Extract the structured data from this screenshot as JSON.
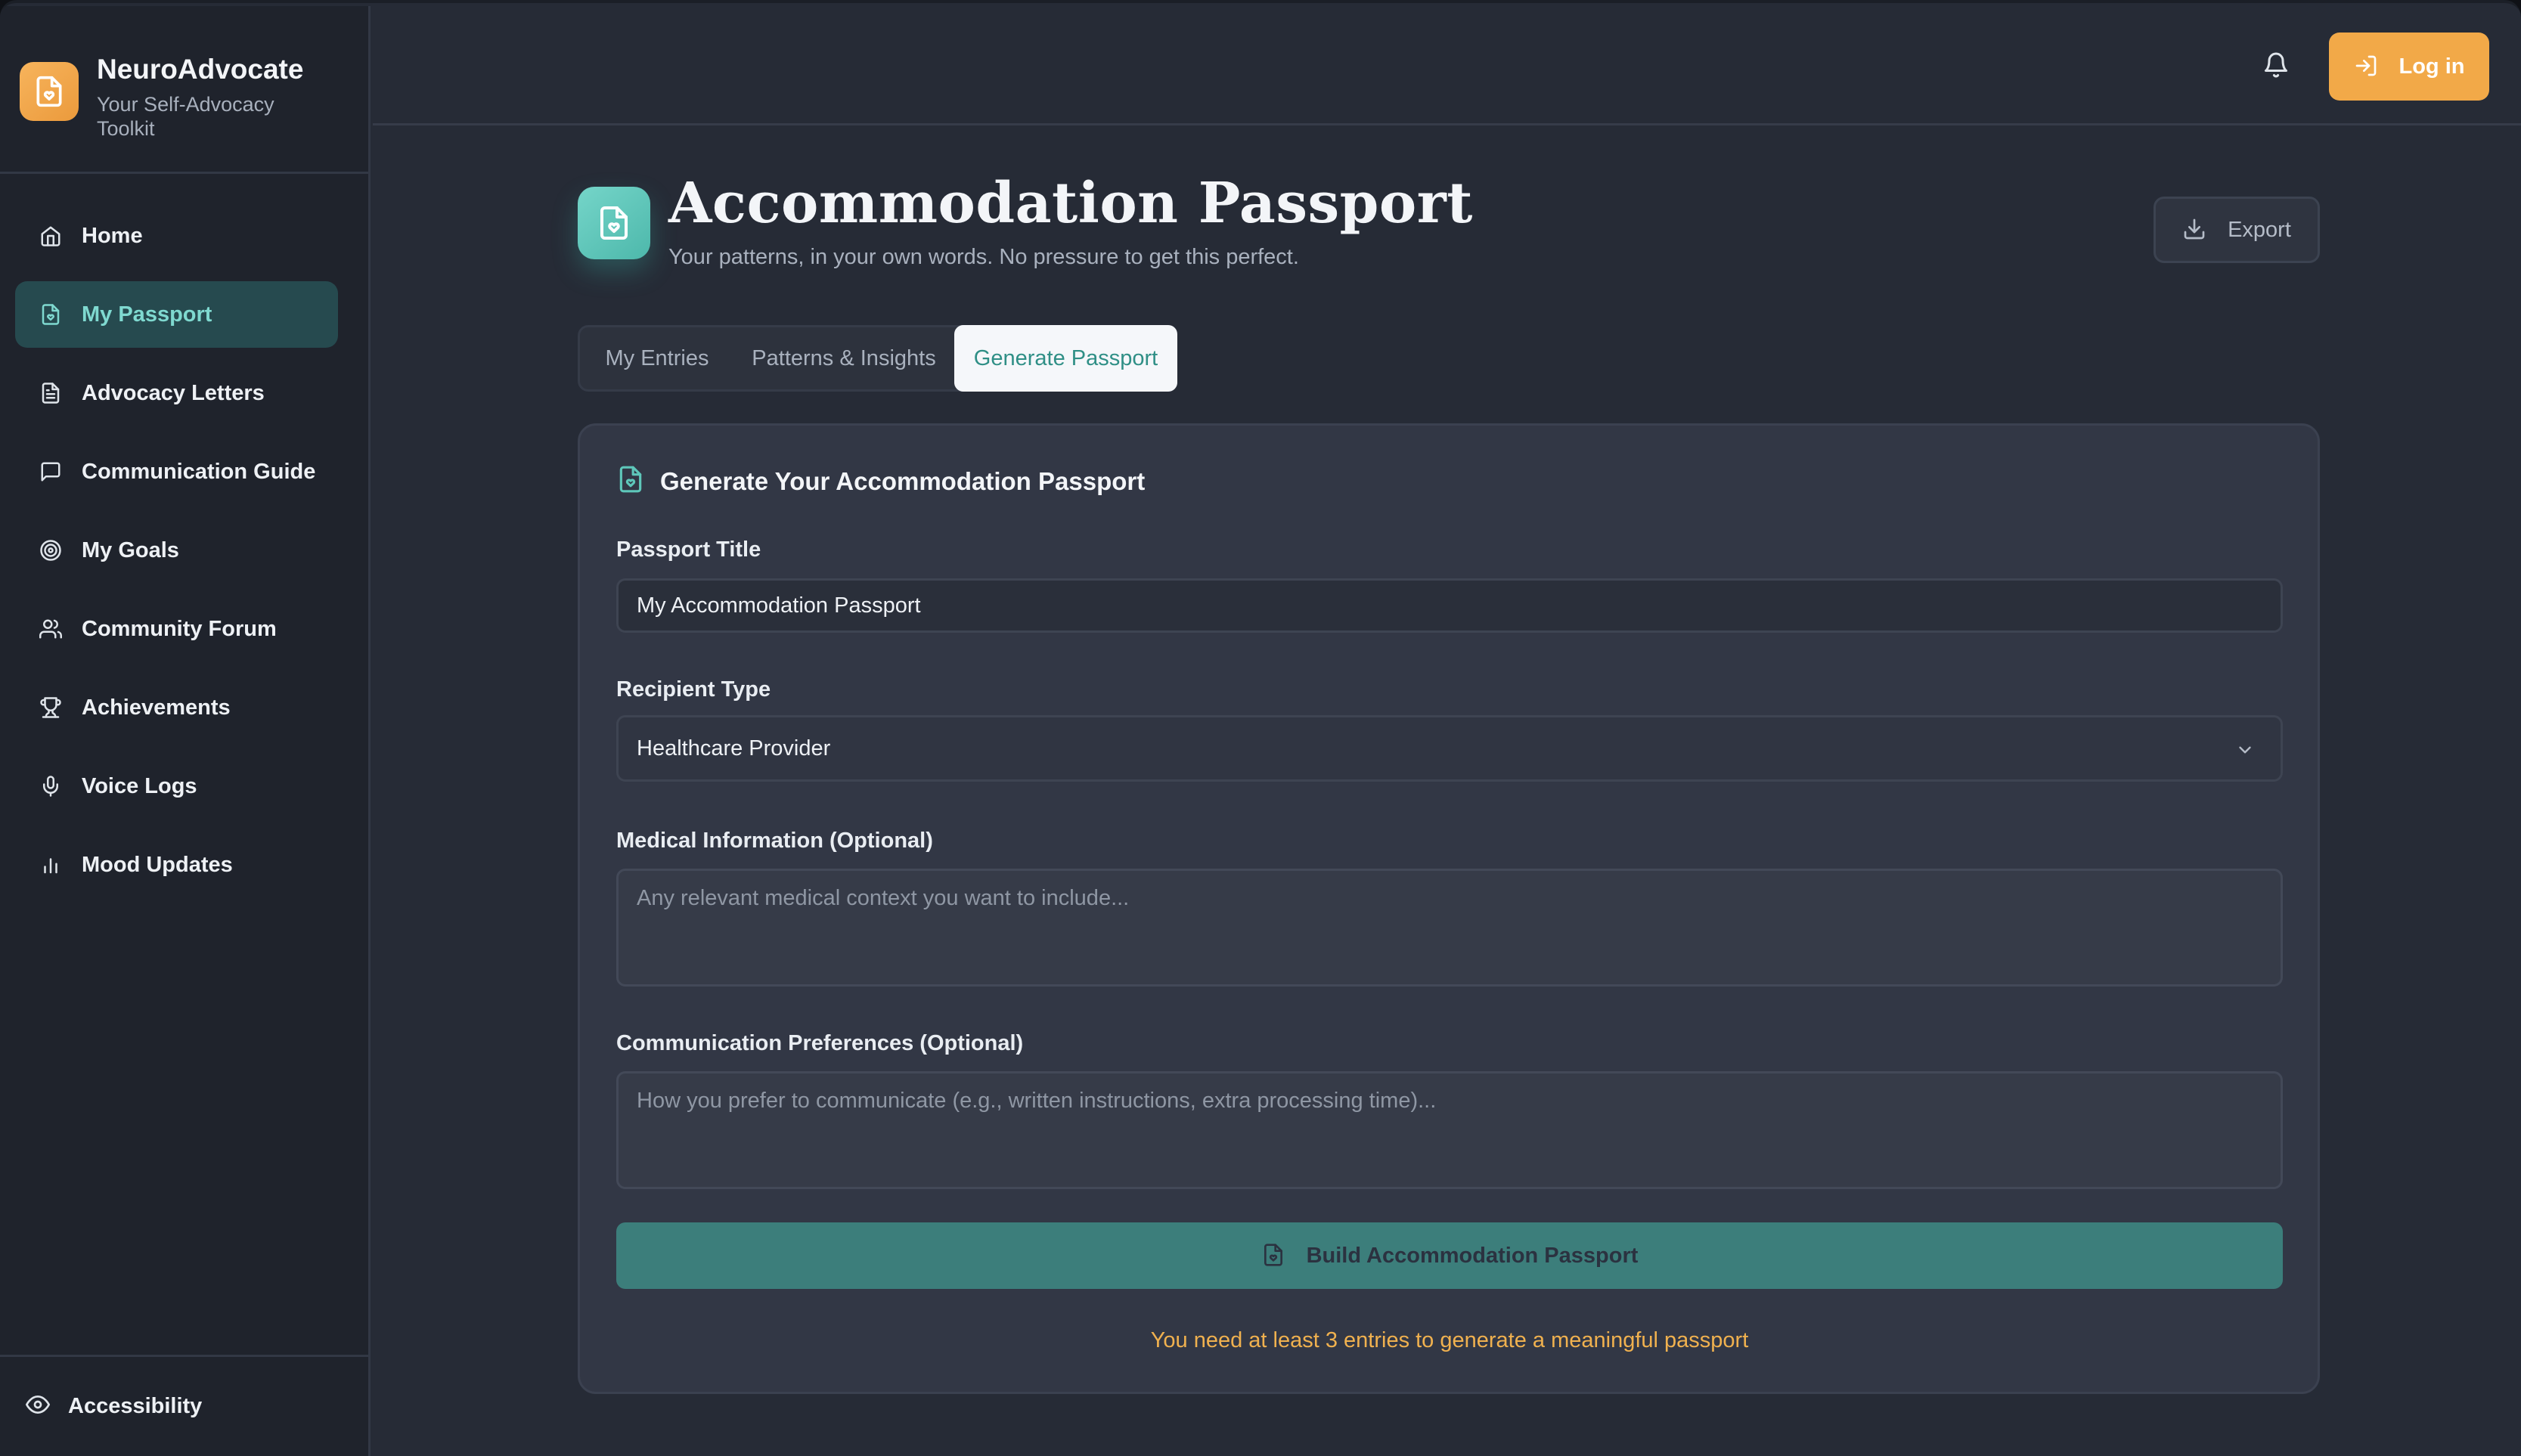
{
  "app": {
    "name": "NeuroAdvocate",
    "tagline": "Your Self-Advocacy Toolkit"
  },
  "sidebar": {
    "items": [
      {
        "label": "Home",
        "icon": "home-icon",
        "active": false
      },
      {
        "label": "My Passport",
        "icon": "passport-file-icon",
        "active": true
      },
      {
        "label": "Advocacy Letters",
        "icon": "document-icon",
        "active": false
      },
      {
        "label": "Communication Guide",
        "icon": "message-square-icon",
        "active": false
      },
      {
        "label": "My Goals",
        "icon": "target-icon",
        "active": false
      },
      {
        "label": "Community Forum",
        "icon": "users-icon",
        "active": false
      },
      {
        "label": "Achievements",
        "icon": "trophy-icon",
        "active": false
      },
      {
        "label": "Voice Logs",
        "icon": "microphone-icon",
        "active": false
      },
      {
        "label": "Mood Updates",
        "icon": "bar-chart-icon",
        "active": false
      }
    ],
    "footer": {
      "label": "Accessibility",
      "icon": "eye-icon"
    }
  },
  "header": {
    "login_label": "Log in",
    "notification_icon": "bell-icon"
  },
  "page": {
    "title": "Accommodation Passport",
    "subtitle": "Your patterns, in your own words. No pressure to get this perfect.",
    "export_label": "Export"
  },
  "tabs": [
    {
      "label": "My Entries",
      "active": false
    },
    {
      "label": "Patterns & Insights",
      "active": false
    },
    {
      "label": "Generate Passport",
      "active": true
    }
  ],
  "form": {
    "heading": "Generate Your Accommodation Passport",
    "passport_title_label": "Passport Title",
    "passport_title_value": "My Accommodation Passport",
    "recipient_label": "Recipient Type",
    "recipient_value": "Healthcare Provider",
    "medical_label": "Medical Information (Optional)",
    "medical_placeholder": "Any relevant medical context you want to include...",
    "communication_label": "Communication Preferences (Optional)",
    "communication_placeholder": "How you prefer to communicate (e.g., written instructions, extra processing time)...",
    "build_label": "Build Accommodation Passport",
    "hint": "You need at least 3 entries to generate a meaningful passport"
  },
  "colors": {
    "accent_teal": "#4db8ab",
    "accent_orange": "#f2a948",
    "warning_text": "#f0b14f",
    "background": "#262b36",
    "sidebar_bg": "#1f232c"
  }
}
